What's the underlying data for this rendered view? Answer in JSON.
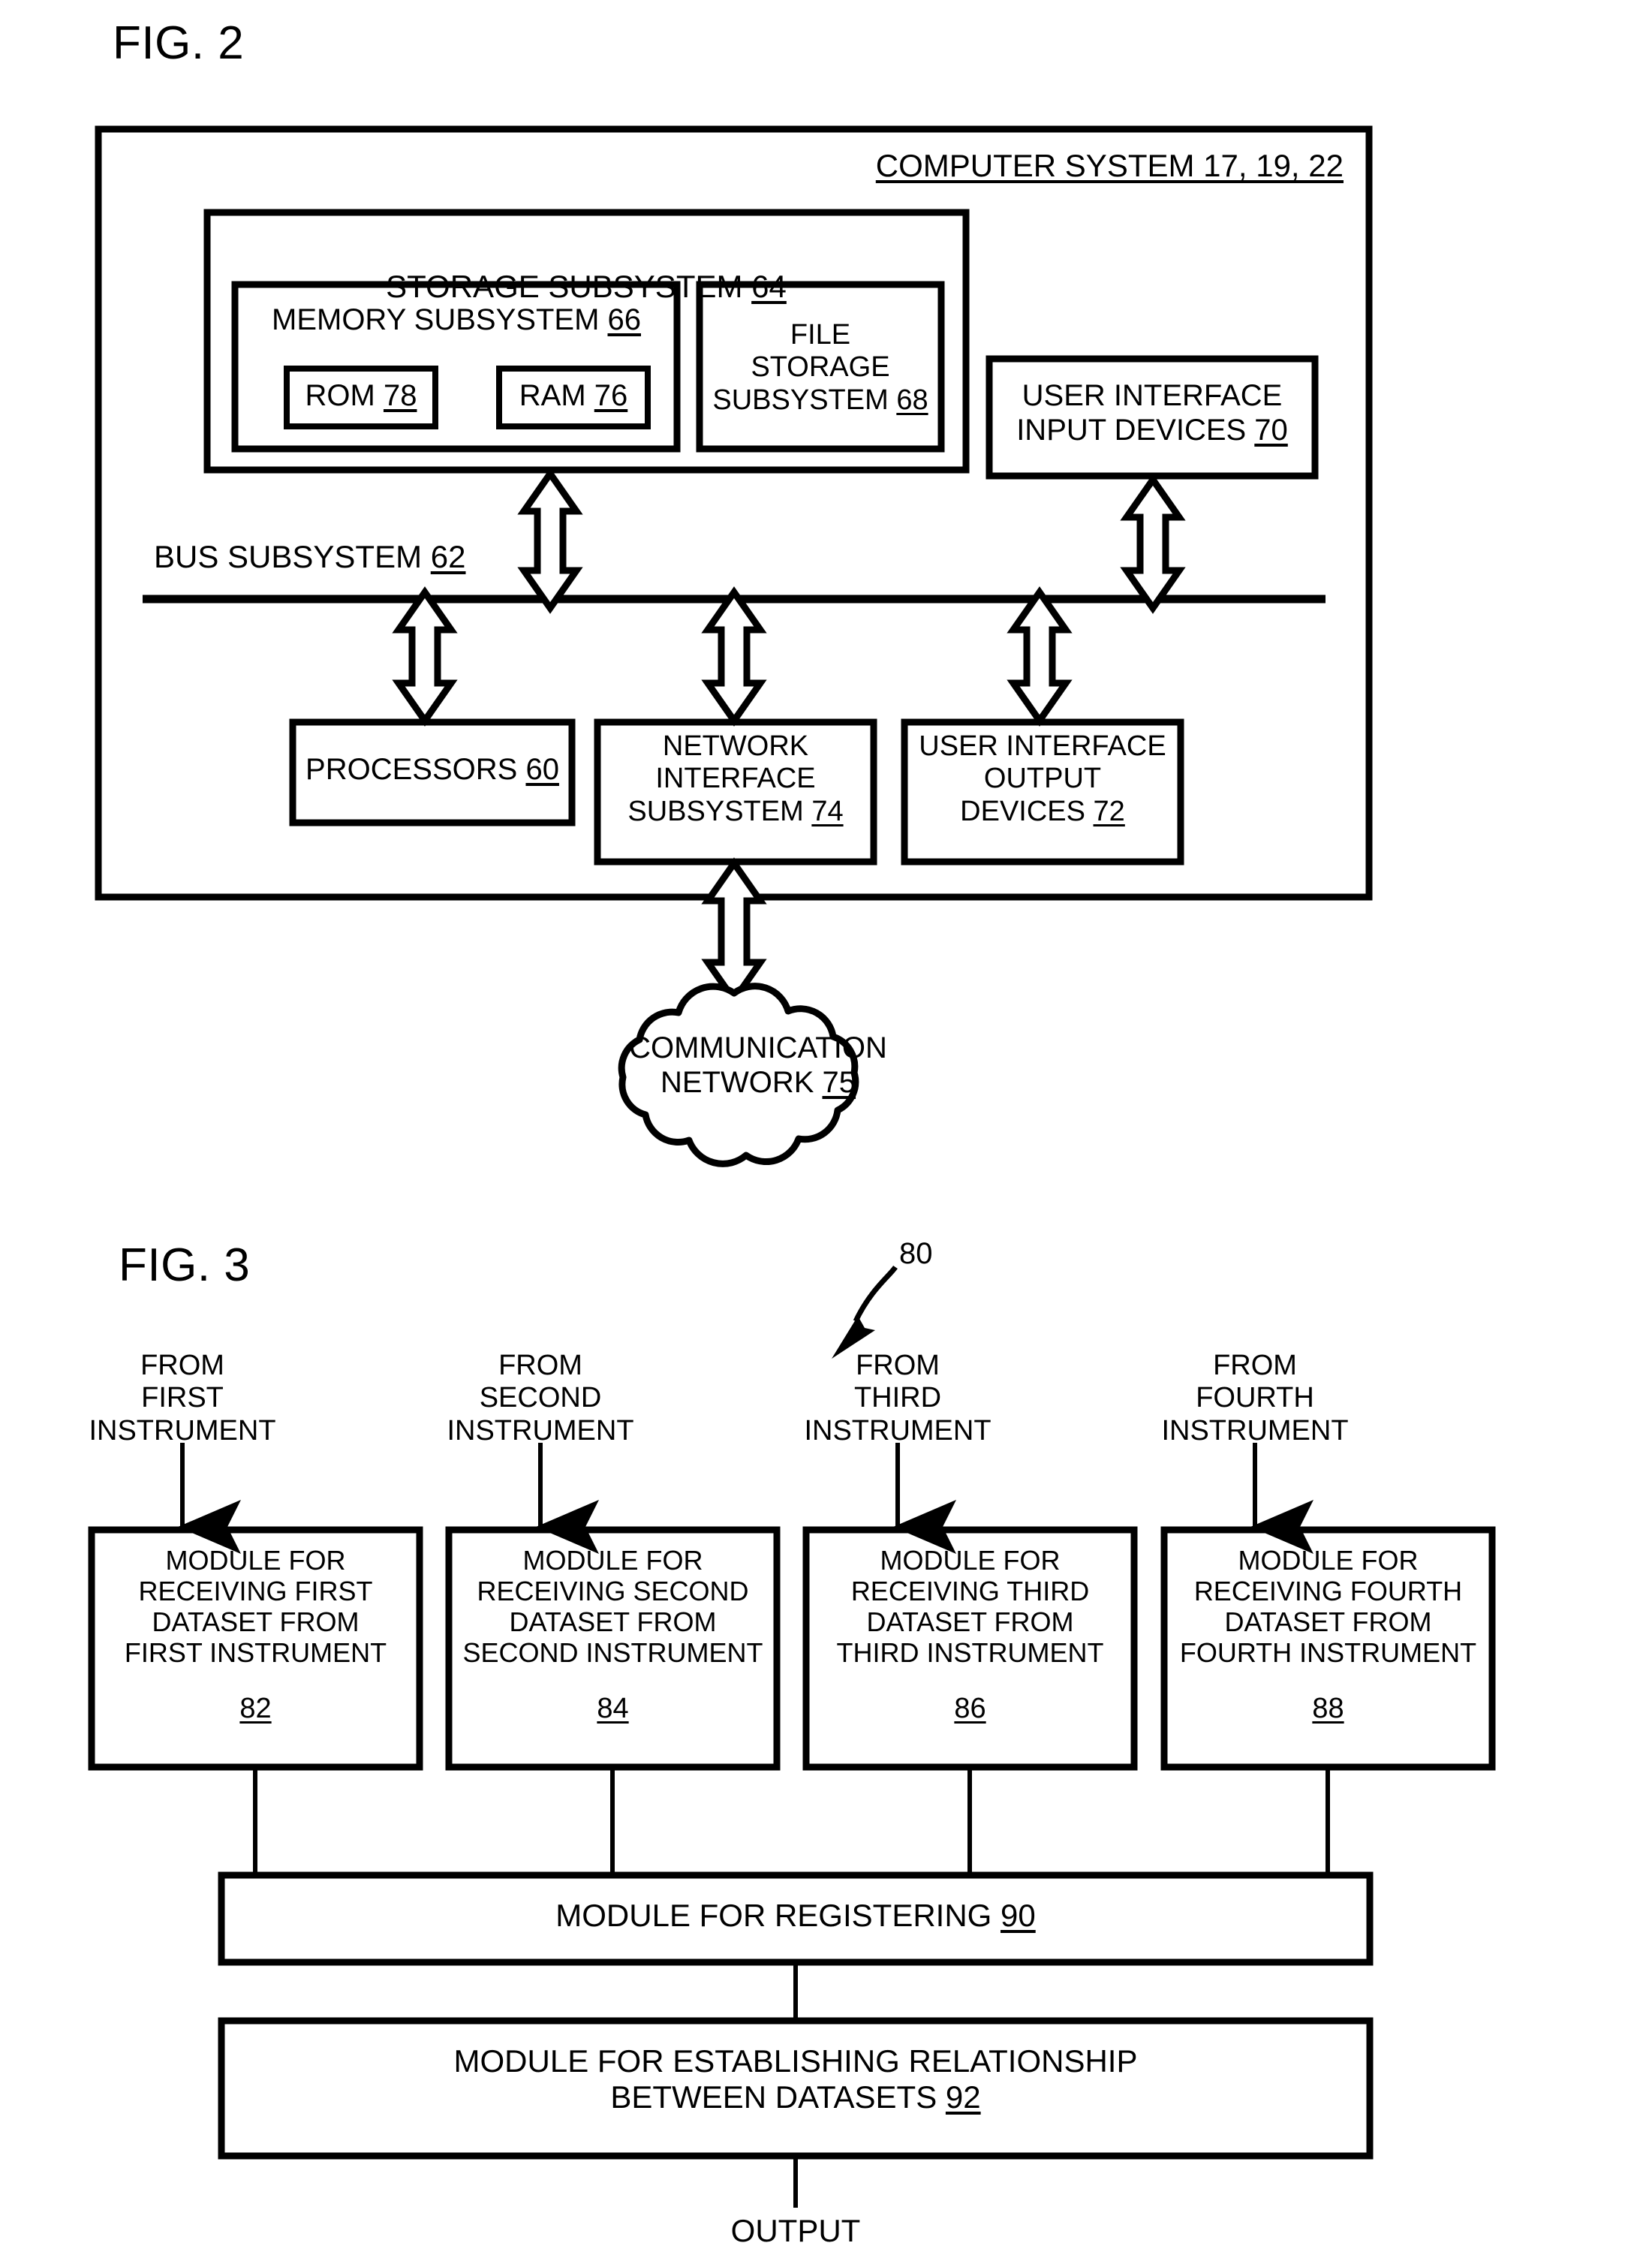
{
  "figures": {
    "fig2": {
      "title": "FIG. 2",
      "computer_system": "COMPUTER SYSTEM 17, 19, 22",
      "storage_subsystem": "STORAGE SUBSYSTEM 64",
      "memory_subsystem": "MEMORY SUBSYSTEM 66",
      "rom": "ROM 78",
      "ram": "RAM 76",
      "file_storage_subsystem": "FILE\nSTORAGE\nSUBSYSTEM 68",
      "user_interface_input_devices": "USER INTERFACE\nINPUT DEVICES 70",
      "bus_subsystem": "BUS SUBSYSTEM 62",
      "processors": "PROCESSORS 60",
      "network_interface_subsystem": "NETWORK\nINTERFACE\nSUBSYSTEM 74",
      "user_interface_output_devices": "USER INTERFACE\nOUTPUT\nDEVICES 72",
      "communication_network": "COMMUNICATION\nNETWORK 75"
    },
    "fig3": {
      "title": "FIG. 3",
      "ref_label": "80",
      "sources": [
        "FROM\nFIRST INSTRUMENT",
        "FROM\nSECOND INSTRUMENT",
        "FROM\nTHIRD INSTRUMENT",
        "FROM\nFOURTH INSTRUMENT"
      ],
      "modules": [
        {
          "text": "MODULE FOR\nRECEIVING FIRST\nDATASET FROM\nFIRST INSTRUMENT",
          "ref": "82"
        },
        {
          "text": "MODULE FOR\nRECEIVING SECOND\nDATASET FROM\nSECOND INSTRUMENT",
          "ref": "84"
        },
        {
          "text": "MODULE FOR\nRECEIVING THIRD\nDATASET FROM\nTHIRD INSTRUMENT",
          "ref": "86"
        },
        {
          "text": "MODULE FOR\nRECEIVING FOURTH\nDATASET FROM\nFOURTH INSTRUMENT",
          "ref": "88"
        }
      ],
      "register_module": "MODULE FOR REGISTERING 90",
      "relationship_module": "MODULE FOR ESTABLISHING RELATIONSHIP\nBETWEEN DATASETS 92",
      "output": "OUTPUT"
    }
  },
  "colors": {
    "ink": "#000000",
    "paper": "#ffffff"
  }
}
